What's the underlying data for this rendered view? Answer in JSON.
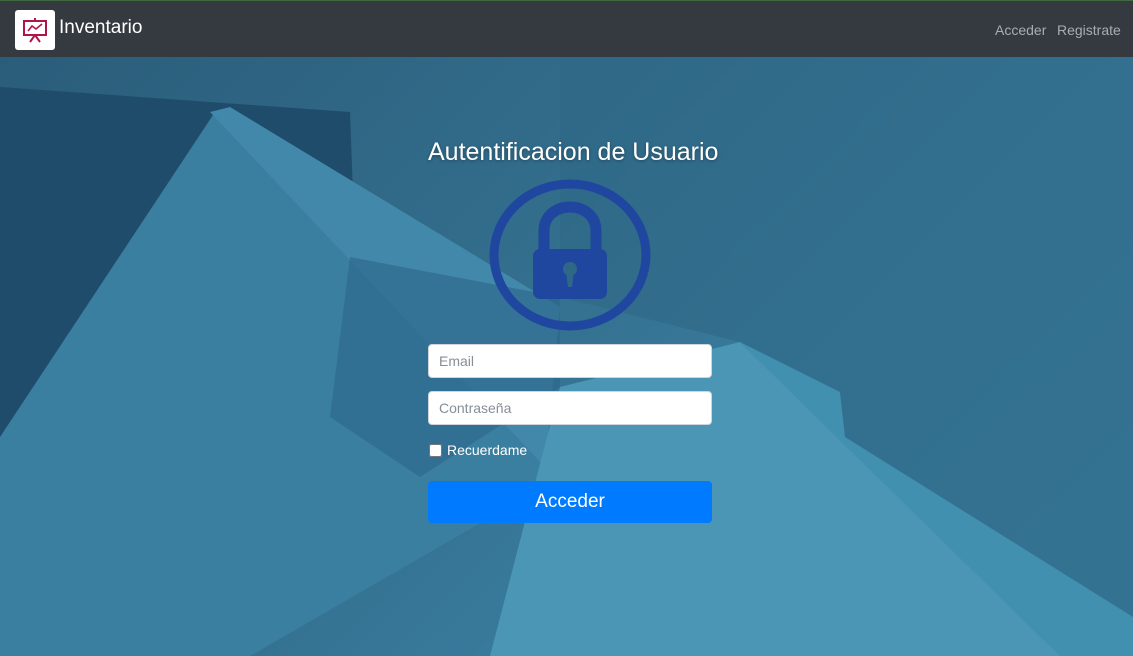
{
  "navbar": {
    "logo_icon": "presentation-chart-icon",
    "brand": "Inventario",
    "links": {
      "login": "Acceder",
      "register": "Registrate"
    }
  },
  "form": {
    "title": "Autentificacion de Usuario",
    "lock_icon": "padlock-icon",
    "email_placeholder": "Email",
    "password_placeholder": "Contraseña",
    "remember_label": "Recuerdame",
    "submit_label": "Acceder"
  },
  "colors": {
    "navbar": "#343a40",
    "brand_logo": "#b0154a",
    "lock": "#1f47a0",
    "primary_button": "#007bff"
  }
}
